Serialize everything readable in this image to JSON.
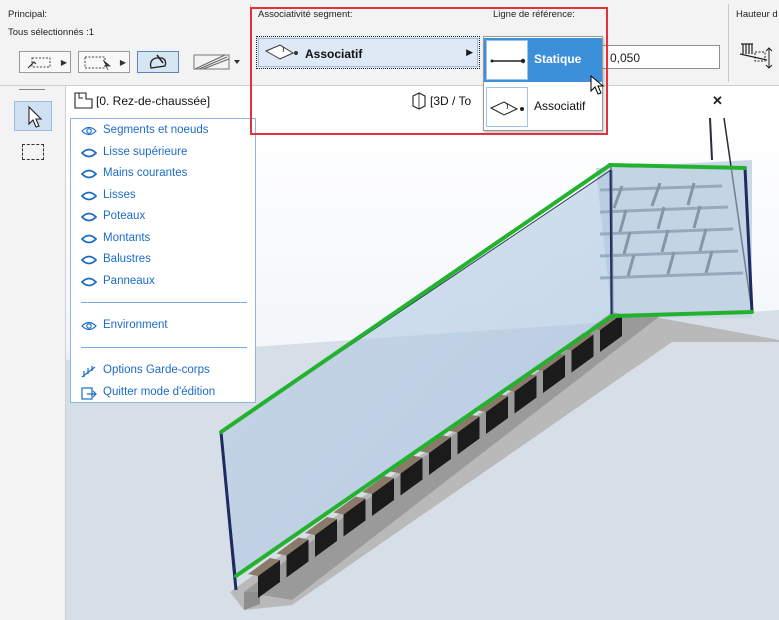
{
  "infobox": {
    "principal_label": "Principal:",
    "selection_count": "Tous sélectionnés :1",
    "segment_assoc_label": "Associativité segment:",
    "segment_assoc_value": "Associatif",
    "ref_line_label": "Ligne de référence:",
    "height_label": "Hauteur d",
    "height_value": "0,050"
  },
  "popup": {
    "items": [
      {
        "label": "Statique",
        "icon": "static-line-icon",
        "selected": true
      },
      {
        "label": "Associatif",
        "icon": "associative-icon",
        "selected": false
      }
    ]
  },
  "tabs": [
    {
      "label": "[0. Rez-de-chaussée]",
      "icon": "floor-plan-icon"
    },
    {
      "label": "[3D / To",
      "icon": "3d-view-icon"
    }
  ],
  "edit_panel": {
    "items": [
      {
        "label": "Segments et noeuds",
        "icon": "eye-icon"
      },
      {
        "label": "Lisse supérieure",
        "icon": "lens-icon"
      },
      {
        "label": "Mains courantes",
        "icon": "lens-icon"
      },
      {
        "label": "Lisses",
        "icon": "lens-icon"
      },
      {
        "label": "Poteaux",
        "icon": "lens-icon"
      },
      {
        "label": "Montants",
        "icon": "lens-icon"
      },
      {
        "label": "Balustres",
        "icon": "lens-icon"
      },
      {
        "label": "Panneaux",
        "icon": "lens-icon"
      }
    ],
    "environment": "Environment",
    "railing_options": "Options Garde-corps",
    "exit_edit": "Quitter mode d'édition"
  },
  "colors": {
    "accent_blue": "#3c8fd9",
    "panel_text": "#1c6cc7",
    "highlight_red": "#e2313b",
    "railing_green": "#22b22e"
  }
}
